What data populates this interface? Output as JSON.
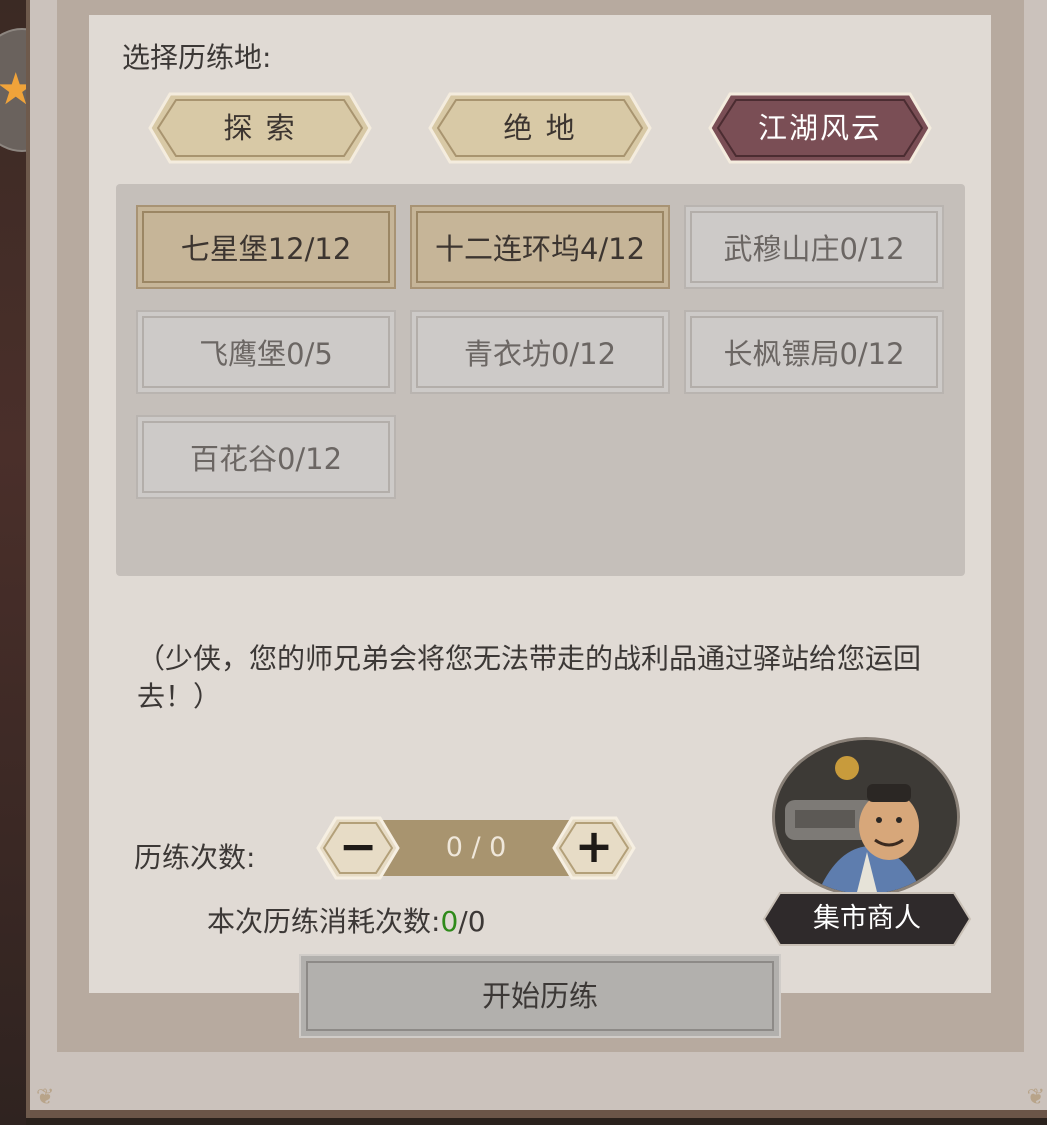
{
  "colors": {
    "tab_light": "#d8c9a6",
    "tab_dark": "#7a4e55",
    "location_active": "#c6b598",
    "location_inactive": "#cdcac8",
    "consume_highlight": "#2f8a1a"
  },
  "header": {
    "select_label": "选择历练地:"
  },
  "tabs": [
    {
      "label": "探 索",
      "selected": false
    },
    {
      "label": "绝 地",
      "selected": false
    },
    {
      "label": "江湖风云",
      "selected": true
    }
  ],
  "locations": [
    {
      "label": "七星堡12/12",
      "active": true
    },
    {
      "label": "十二连环坞4/12",
      "active": true
    },
    {
      "label": "武穆山庄0/12",
      "active": false
    },
    {
      "label": "飞鹰堡0/5",
      "active": false
    },
    {
      "label": "青衣坊0/12",
      "active": false
    },
    {
      "label": "长枫镖局0/12",
      "active": false
    },
    {
      "label": "百花谷0/12",
      "active": false
    }
  ],
  "note": "（少侠，您的师兄弟会将您无法带走的战利品通过驿站给您运回去！）",
  "count": {
    "label": "历练次数:",
    "value": "0 / 0",
    "minus_icon": "minus-icon",
    "plus_icon": "plus-icon"
  },
  "consume": {
    "label": "本次历练消耗次数:",
    "used": "0",
    "total": "/0"
  },
  "start_button": {
    "label": "开始历练"
  },
  "merchant": {
    "label": "集市商人",
    "icon": "merchant-portrait"
  }
}
